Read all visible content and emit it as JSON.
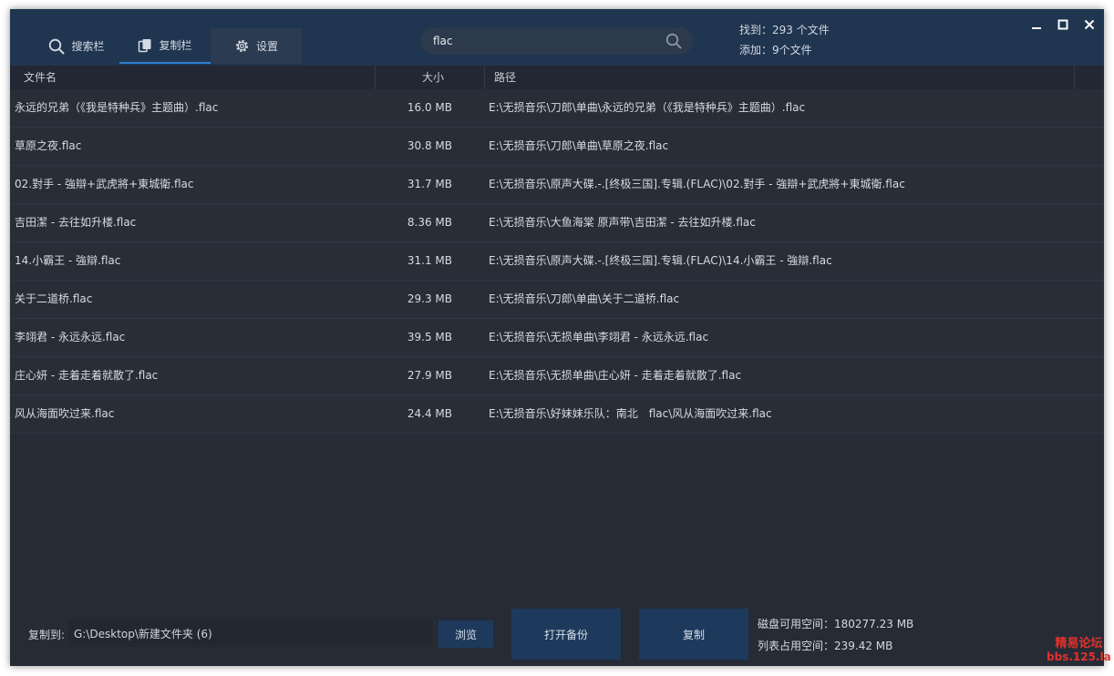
{
  "tabs": {
    "search_label": "搜索栏",
    "copy_label": "复制栏",
    "settings_label": "设置",
    "active": "复制栏"
  },
  "search": {
    "value": "flac",
    "placeholder": ""
  },
  "stats": {
    "found": "找到：293 个文件",
    "added": "添加：9个文件"
  },
  "window_controls": {
    "minimize_icon": "minimize-icon",
    "maximize_icon": "maximize-icon",
    "close_icon": "close-icon"
  },
  "table": {
    "columns": {
      "name": "文件名",
      "size": "大小",
      "path": "路径"
    },
    "rows": [
      {
        "name": "永远的兄弟（《我是特种兵》主题曲）.flac",
        "size": "16.0 MB",
        "path": "E:\\无损音乐\\刀郎\\单曲\\永远的兄弟（《我是特种兵》主题曲）.flac"
      },
      {
        "name": "草原之夜.flac",
        "size": "30.8 MB",
        "path": "E:\\无损音乐\\刀郎\\单曲\\草原之夜.flac"
      },
      {
        "name": "02.對手 - 強辯+武虎將+東城衛.flac",
        "size": "31.7 MB",
        "path": "E:\\无损音乐\\原声大碟.-.[终极三国].专辑.(FLAC)\\02.對手 - 強辯+武虎將+東城衛.flac"
      },
      {
        "name": "吉田潔 - 去往如升楼.flac",
        "size": "8.36 MB",
        "path": "E:\\无损音乐\\大鱼海棠 原声带\\吉田潔 - 去往如升楼.flac"
      },
      {
        "name": "14.小霸王 - 強辯.flac",
        "size": "31.1 MB",
        "path": "E:\\无损音乐\\原声大碟.-.[终极三国].专辑.(FLAC)\\14.小霸王 - 強辯.flac"
      },
      {
        "name": "关于二道桥.flac",
        "size": "29.3 MB",
        "path": "E:\\无损音乐\\刀郎\\单曲\\关于二道桥.flac"
      },
      {
        "name": "李翊君 - 永远永远.flac",
        "size": "39.5 MB",
        "path": "E:\\无损音乐\\无损单曲\\李翊君 - 永远永远.flac"
      },
      {
        "name": "庄心妍 - 走着走着就散了.flac",
        "size": "27.9 MB",
        "path": "E:\\无损音乐\\无损单曲\\庄心妍 - 走着走着就散了.flac"
      },
      {
        "name": "风从海面吹过来.flac",
        "size": "24.4 MB",
        "path": "E:\\无损音乐\\好妹妹乐队：南北　flac\\风从海面吹过来.flac"
      }
    ]
  },
  "footer": {
    "copy_to_label": "复制到:",
    "copy_to_value": "G:\\Desktop\\新建文件夹 (6)",
    "browse_label": "浏览",
    "open_backup_label": "打开备份",
    "copy_label": "复制",
    "disk_free": "磁盘可用空间：180277.23 MB",
    "list_used": "列表占用空间：239.42 MB"
  },
  "watermark": {
    "line1": "精易论坛",
    "line2": "bbs.125.la"
  },
  "colors": {
    "titlebar": "#1f3550",
    "background": "#262b36",
    "accent": "#2f7fd8",
    "button": "#1d3a5c"
  }
}
